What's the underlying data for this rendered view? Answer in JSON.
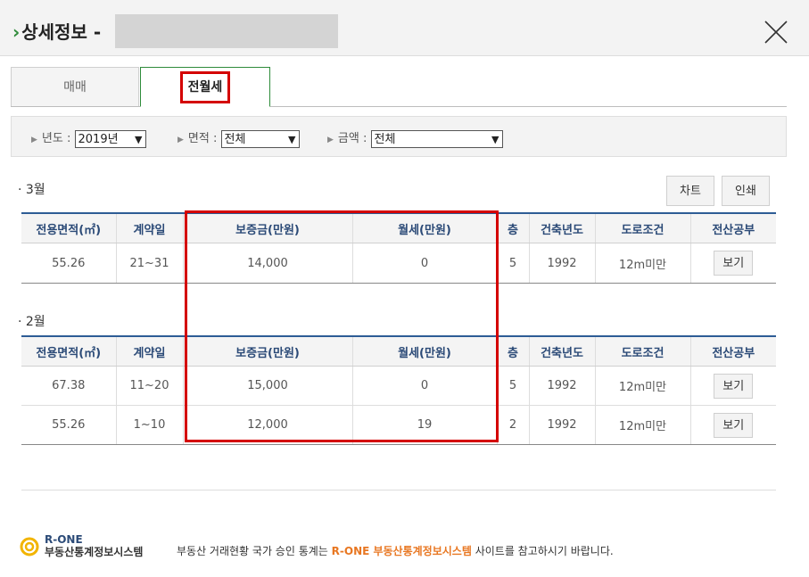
{
  "header": {
    "title": "상세정보 -"
  },
  "tabs": [
    {
      "label": "매매",
      "active": false
    },
    {
      "label": "전월세",
      "active": true
    }
  ],
  "filters": [
    {
      "label": "년도 :",
      "value": "2019년"
    },
    {
      "label": "면적 :",
      "value": "전체"
    },
    {
      "label": "금액 :",
      "value": "전체"
    }
  ],
  "buttons": {
    "chart": "차트",
    "print": "인쇄"
  },
  "columns": [
    "전용면적(㎡)",
    "계약일",
    "보증금(만원)",
    "월세(만원)",
    "층",
    "건축년도",
    "도로조건",
    "전산공부"
  ],
  "sections": [
    {
      "month": "· 3월",
      "rows": [
        {
          "area": "55.26",
          "date": "21~31",
          "deposit": "14,000",
          "rent": "0",
          "floor": "5",
          "year": "1992",
          "road": "12m미만",
          "view": "보기"
        }
      ]
    },
    {
      "month": "· 2월",
      "rows": [
        {
          "area": "67.38",
          "date": "11~20",
          "deposit": "15,000",
          "rent": "0",
          "floor": "5",
          "year": "1992",
          "road": "12m미만",
          "view": "보기"
        },
        {
          "area": "55.26",
          "date": "1~10",
          "deposit": "12,000",
          "rent": "19",
          "floor": "2",
          "year": "1992",
          "road": "12m미만",
          "view": "보기"
        }
      ]
    }
  ],
  "footer": {
    "logo_name": "R-ONE",
    "logo_sub": "부동산통계정보시스템",
    "text_pre": "부동산 거래현황 국가 승인 통계는 ",
    "text_hl": "R-ONE 부동산통계정보시스템",
    "text_post": " 사이트를 참고하시기 바랍니다."
  },
  "colors": {
    "accent_green": "#2e8b3a",
    "highlight_red": "#d40000",
    "table_header_blue": "#2b4a77",
    "link_orange": "#e87722"
  }
}
